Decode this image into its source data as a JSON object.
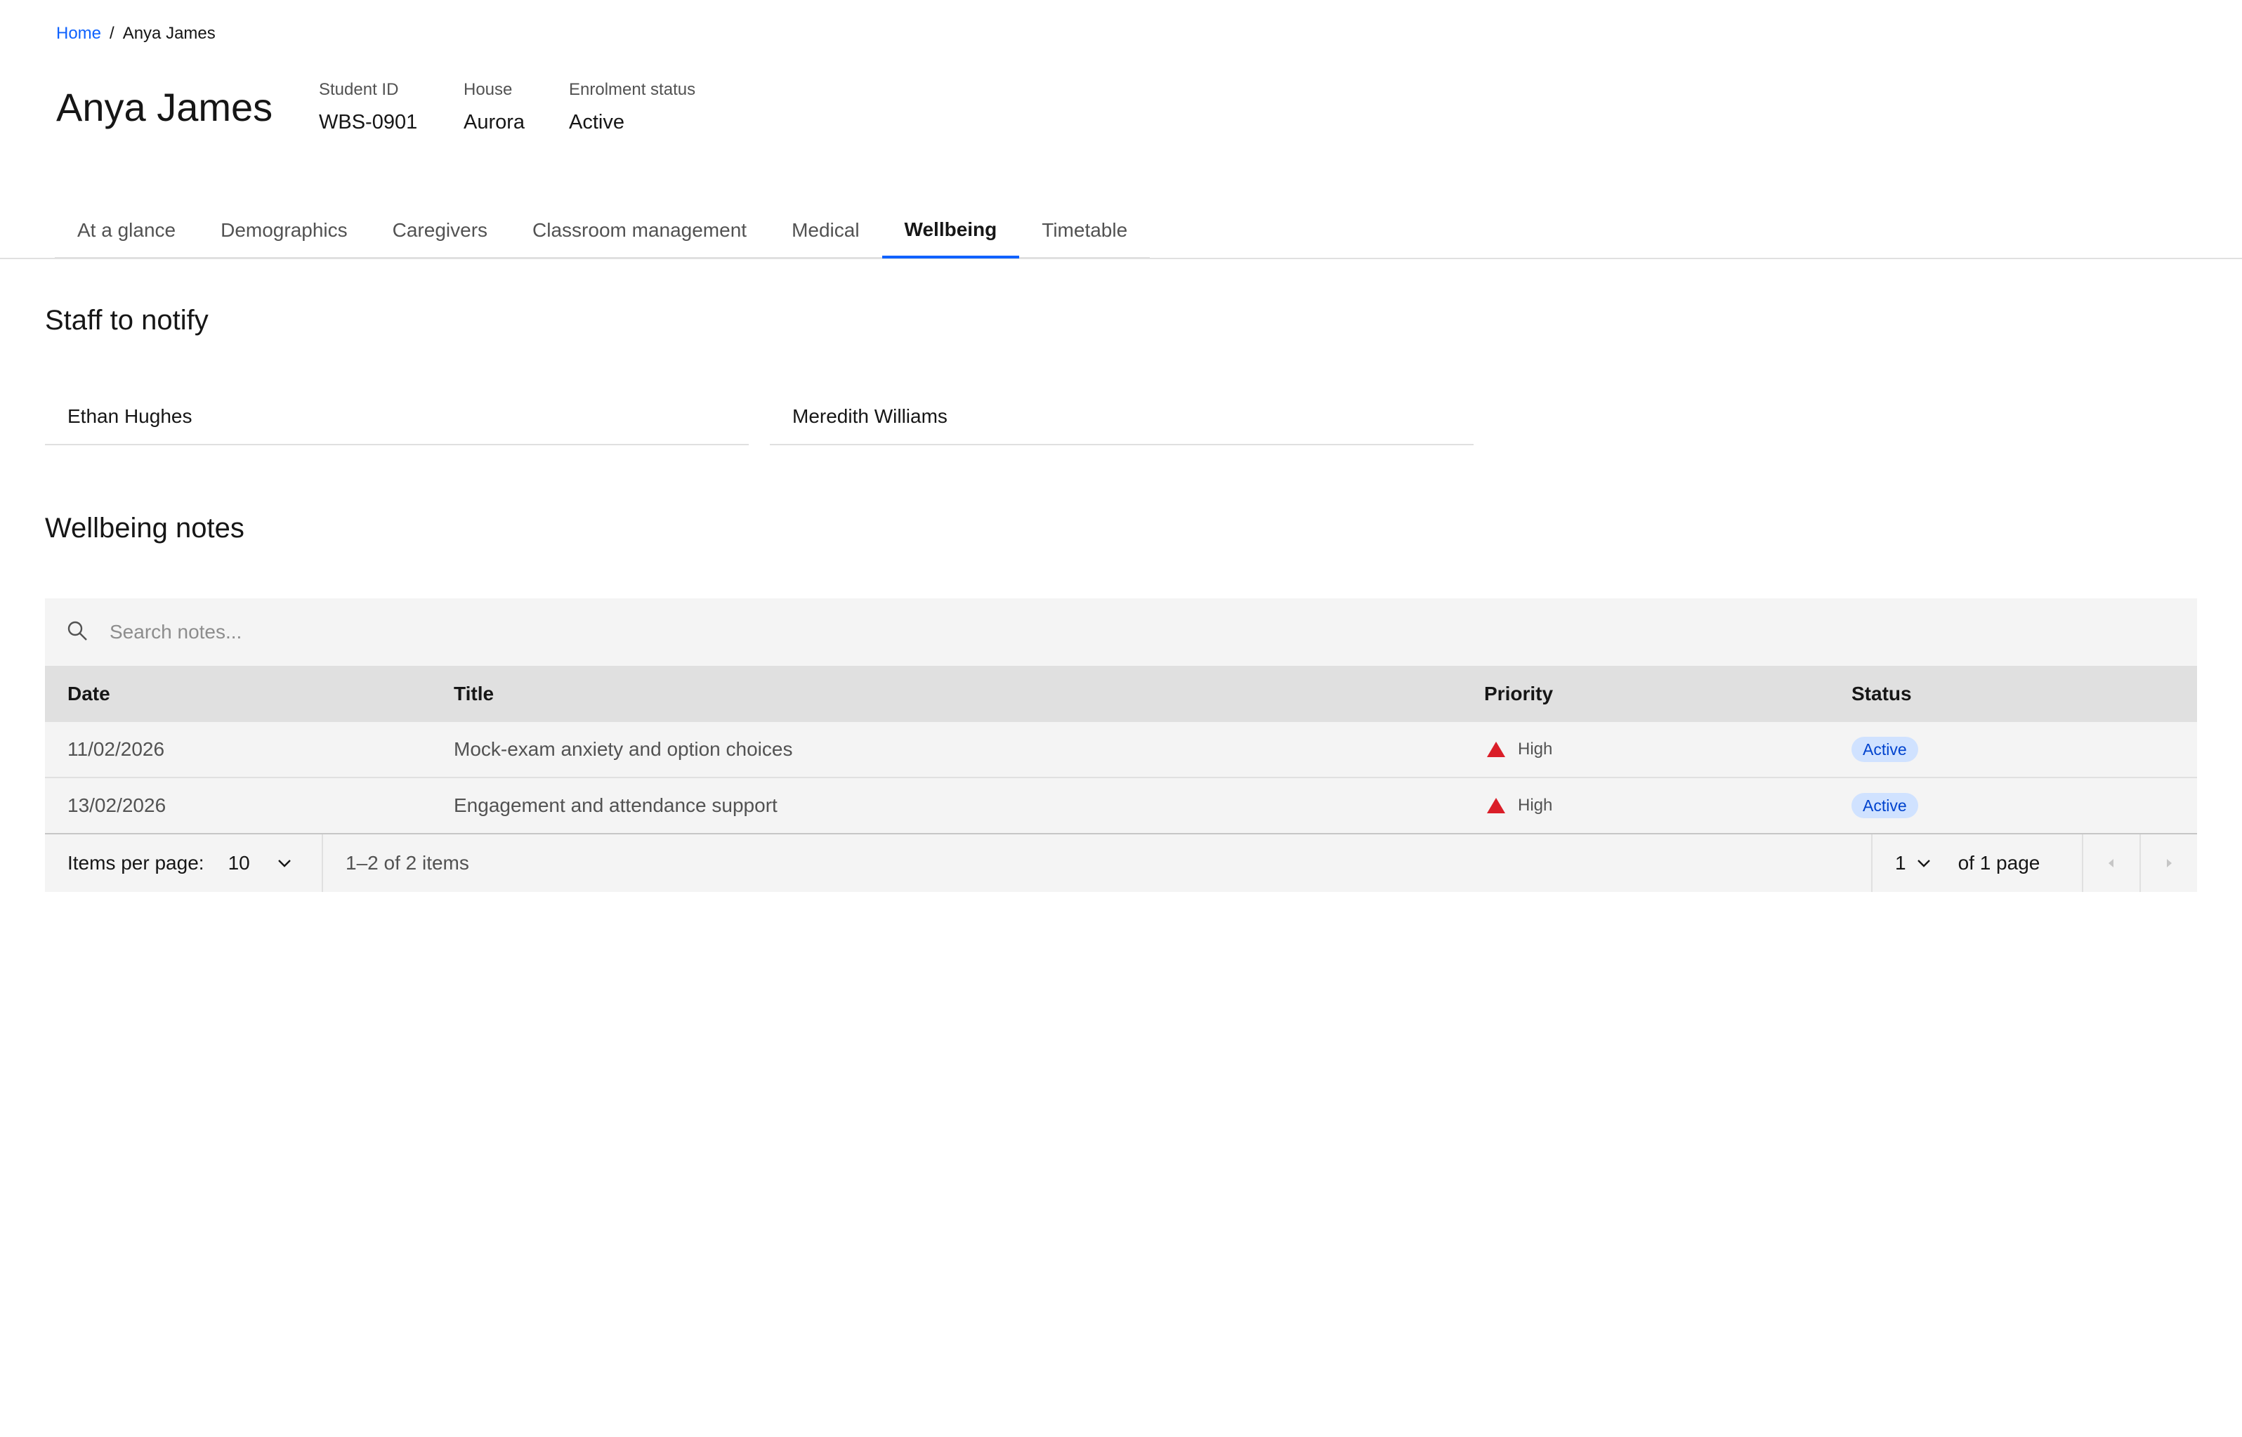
{
  "breadcrumb": {
    "home": "Home",
    "separator": "/",
    "current": "Anya James"
  },
  "student": {
    "name": "Anya James",
    "meta": [
      {
        "label": "Student ID",
        "value": "WBS-0901"
      },
      {
        "label": "House",
        "value": "Aurora"
      },
      {
        "label": "Enrolment status",
        "value": "Active"
      }
    ]
  },
  "tabs": [
    {
      "label": "At a glance"
    },
    {
      "label": "Demographics"
    },
    {
      "label": "Caregivers"
    },
    {
      "label": "Classroom management"
    },
    {
      "label": "Medical"
    },
    {
      "label": "Wellbeing",
      "active": true
    },
    {
      "label": "Timetable"
    }
  ],
  "staff": {
    "title": "Staff to notify",
    "people": [
      "Ethan Hughes",
      "Meredith Williams"
    ]
  },
  "notes": {
    "title": "Wellbeing notes",
    "search_placeholder": "Search notes...",
    "headers": {
      "date": "Date",
      "title": "Title",
      "priority": "Priority",
      "status": "Status"
    },
    "rows": [
      {
        "date": "11/02/2026",
        "title": "Mock-exam anxiety and option choices",
        "priority": "High",
        "status": "Active"
      },
      {
        "date": "13/02/2026",
        "title": "Engagement and attendance support",
        "priority": "High",
        "status": "Active"
      }
    ],
    "pagination": {
      "items_per_page_label": "Items per page:",
      "items_per_page": "10",
      "range": "1–2 of 2 items",
      "page": "1",
      "of_pages": "of 1 page"
    }
  },
  "colors": {
    "accent": "#0f62fe",
    "priority_high": "#da1e28",
    "badge_bg": "#d0e2ff",
    "badge_text": "#0043ce"
  },
  "icons": {
    "search": "search-icon",
    "chevron": "chevron-down-icon",
    "prev": "caret-left-icon",
    "next": "caret-right-icon",
    "priority": "warning-triangle-icon"
  }
}
